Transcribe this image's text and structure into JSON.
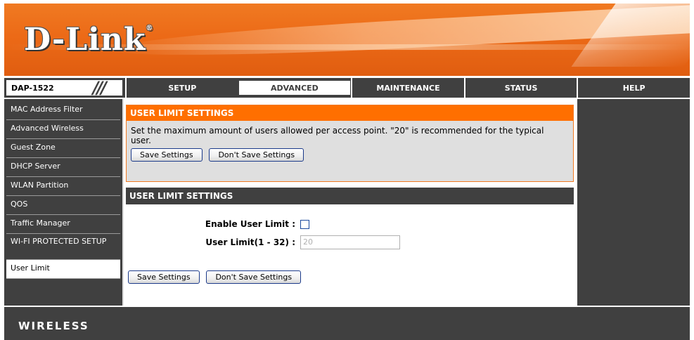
{
  "brand": {
    "logo": "D-Link",
    "logo_mark": "®"
  },
  "nav": {
    "model": "DAP-1522",
    "tabs": [
      "SETUP",
      "ADVANCED",
      "MAINTENANCE",
      "STATUS",
      "HELP"
    ],
    "active_tab": "ADVANCED"
  },
  "sidebar": {
    "items": [
      "MAC Address Filter",
      "Advanced Wireless",
      "Guest Zone",
      "DHCP Server",
      "WLAN Partition",
      "QOS",
      "Traffic Manager",
      "WI-FI PROTECTED SETUP",
      "User Limit"
    ],
    "active_item": "User Limit"
  },
  "intro": {
    "title": "USER LIMIT SETTINGS",
    "description": "Set the maximum amount of users allowed per access point. \"20\" is recommended for the typical user.",
    "save_label": "Save Settings",
    "dont_save_label": "Don't Save Settings"
  },
  "settings": {
    "title": "USER LIMIT SETTINGS",
    "enable_label": "Enable User Limit :",
    "enable_checked": false,
    "limit_label": "User Limit(1 - 32) :",
    "limit_value": "20",
    "save_label": "Save Settings",
    "dont_save_label": "Don't Save Settings"
  },
  "footer": {
    "brand": "WIRELESS"
  },
  "colors": {
    "accent": "#ff6f00",
    "dark": "#404040",
    "panel": "#dfdfdf"
  }
}
